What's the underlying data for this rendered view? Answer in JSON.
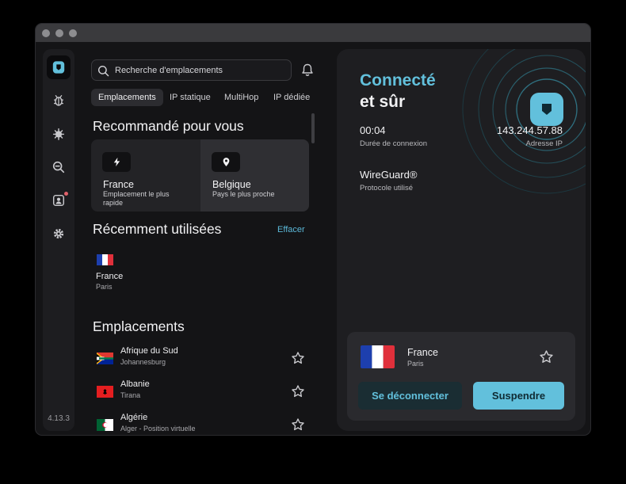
{
  "app": {
    "version": "4.13.3"
  },
  "sidebar": {
    "items": [
      {
        "icon": "shield-icon",
        "active": true
      },
      {
        "icon": "bug-icon"
      },
      {
        "icon": "virus-icon"
      },
      {
        "icon": "zoom-out-icon"
      },
      {
        "icon": "contact-card-icon",
        "badge": true
      },
      {
        "icon": "gear-icon"
      }
    ]
  },
  "search": {
    "placeholder": "Recherche d'emplacements"
  },
  "tabs": [
    {
      "label": "Emplacements",
      "active": true
    },
    {
      "label": "IP statique"
    },
    {
      "label": "MultiHop"
    },
    {
      "label": "IP dédiée"
    }
  ],
  "recommended": {
    "title": "Recommandé pour vous",
    "cards": [
      {
        "icon": "lightning-icon",
        "title": "France",
        "subtitle": "Emplacement le plus rapide"
      },
      {
        "icon": "map-pin-icon",
        "title": "Belgique",
        "subtitle": "Pays le plus proche"
      }
    ]
  },
  "recent": {
    "title": "Récemment utilisées",
    "clear_label": "Effacer",
    "items": [
      {
        "name": "France",
        "city": "Paris",
        "flag": "fr"
      }
    ]
  },
  "locations": {
    "title": "Emplacements",
    "items": [
      {
        "name": "Afrique du Sud",
        "city": "Johannesburg",
        "flag": "za"
      },
      {
        "name": "Albanie",
        "city": "Tirana",
        "flag": "al"
      },
      {
        "name": "Algérie",
        "city": "Alger - Position virtuelle",
        "flag": "dz"
      }
    ]
  },
  "connection": {
    "status_line1": "Connecté",
    "status_line2": "et sûr",
    "duration": "00:04",
    "duration_label": "Durée de connexion",
    "ip": "143.244.57.88",
    "ip_label": "Adresse IP",
    "protocol": "WireGuard®",
    "protocol_label": "Protocole utilisé",
    "country": "France",
    "city": "Paris",
    "disconnect_label": "Se déconnecter",
    "pause_label": "Suspendre"
  },
  "colors": {
    "accent": "#62c0dc",
    "background": "#141416",
    "panel": "#1e1e21"
  }
}
